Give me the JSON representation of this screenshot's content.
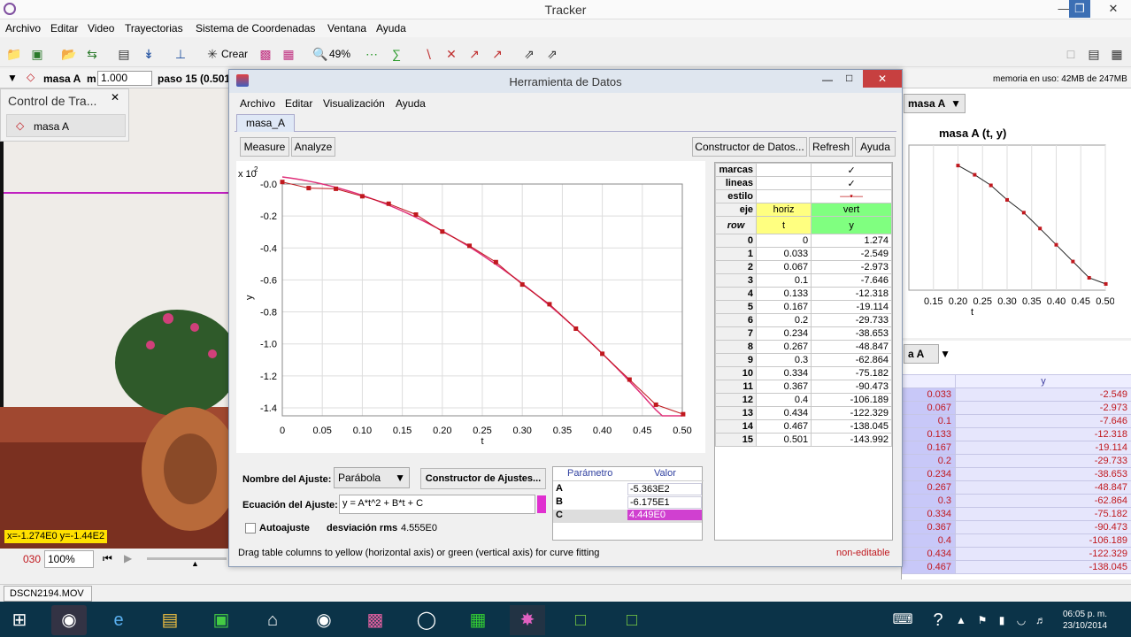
{
  "app": {
    "title": "Tracker"
  },
  "menu": [
    "Archivo",
    "Editar",
    "Video",
    "Trayectorias",
    "Sistema de Coordenadas",
    "Ventana",
    "Ayuda"
  ],
  "toolbar": {
    "zoom_label": "49%",
    "create_label": "Crear"
  },
  "trackbar": {
    "mass_label": "masa A",
    "m_label": "m",
    "m_value": "1.000",
    "step_label": "paso 15 (0.501",
    "memory": "memoria en uso: 42MB de 247MB"
  },
  "control_panel": {
    "title": "Control de Tra...",
    "item": "masa A"
  },
  "video": {
    "readout": "x=-1.274E0  y=-1.44E2",
    "frame": "030",
    "zoom": "100%",
    "file": "DSCN2194.MOV"
  },
  "datatool": {
    "title": "Herramienta de Datos",
    "menu": [
      "Archivo",
      "Editar",
      "Visualización",
      "Ayuda"
    ],
    "tab": "masa_A",
    "buttons": {
      "measure": "Measure",
      "analyze": "Analyze",
      "builder": "Constructor de Datos...",
      "refresh": "Refresh",
      "help": "Ayuda"
    },
    "fit": {
      "name_label": "Nombre del Ajuste:",
      "name_value": "Parábola",
      "builder": "Constructor de Ajustes...",
      "eq_label": "Ecuación del Ajuste:",
      "eq_value": "y = A*t^2 + B*t + C",
      "auto_label": "Autoajuste",
      "rms_label": "desviación rms",
      "rms_value": "4.555E0"
    },
    "params": {
      "col_param": "Parámetro",
      "col_value": "Valor",
      "rows": [
        [
          "A",
          "-5.363E2"
        ],
        [
          "B",
          "-6.175E1"
        ],
        [
          "C",
          "4.449E0"
        ]
      ]
    },
    "status": "Drag table columns to yellow (horizontal axis) or green (vertical axis) for curve fitting",
    "noneditable": "non-editable",
    "table": {
      "marcas": "marcas",
      "lineas": "lineas",
      "estilo": "estilo",
      "eje": "eje",
      "horiz": "horiz",
      "vert": "vert",
      "col_row": "row",
      "col_t": "t",
      "col_y": "y"
    }
  },
  "right_panel": {
    "dropdown1": "masa A",
    "plot_title": "masa A (t, y)",
    "dropdown2": "a A",
    "col_y": "y"
  },
  "taskbar": {
    "time": "06:05 p. m.",
    "date": "23/10/2014"
  },
  "colors": {
    "accent": "#c0181e",
    "fit": "#e0307a",
    "yellow": "#ffff80",
    "green": "#80ff80"
  },
  "chart_data": {
    "type": "scatter",
    "xlabel": "t",
    "ylabel": "y",
    "y_multiplier_label": "x 10",
    "xlim": [
      0,
      0.5
    ],
    "ylim": [
      -1.45,
      0.0
    ],
    "xticks": [
      "0",
      "0.05",
      "0.10",
      "0.15",
      "0.20",
      "0.25",
      "0.30",
      "0.35",
      "0.40",
      "0.45",
      "0.50"
    ],
    "yticks": [
      "-0.0",
      "-0.2",
      "-0.4",
      "-0.6",
      "-0.8",
      "-1.0",
      "-1.2",
      "-1.4"
    ],
    "rows": [
      [
        "0",
        "0",
        "1.274"
      ],
      [
        "1",
        "0.033",
        "-2.549"
      ],
      [
        "2",
        "0.067",
        "-2.973"
      ],
      [
        "3",
        "0.1",
        "-7.646"
      ],
      [
        "4",
        "0.133",
        "-12.318"
      ],
      [
        "5",
        "0.167",
        "-19.114"
      ],
      [
        "6",
        "0.2",
        "-29.733"
      ],
      [
        "7",
        "0.234",
        "-38.653"
      ],
      [
        "8",
        "0.267",
        "-48.847"
      ],
      [
        "9",
        "0.3",
        "-62.864"
      ],
      [
        "10",
        "0.334",
        "-75.182"
      ],
      [
        "11",
        "0.367",
        "-90.473"
      ],
      [
        "12",
        "0.4",
        "-106.189"
      ],
      [
        "13",
        "0.434",
        "-122.329"
      ],
      [
        "14",
        "0.467",
        "-138.045"
      ],
      [
        "15",
        "0.501",
        "-143.992"
      ]
    ],
    "fit": {
      "A": -536.3,
      "B": -61.75,
      "C": 4.449
    }
  }
}
